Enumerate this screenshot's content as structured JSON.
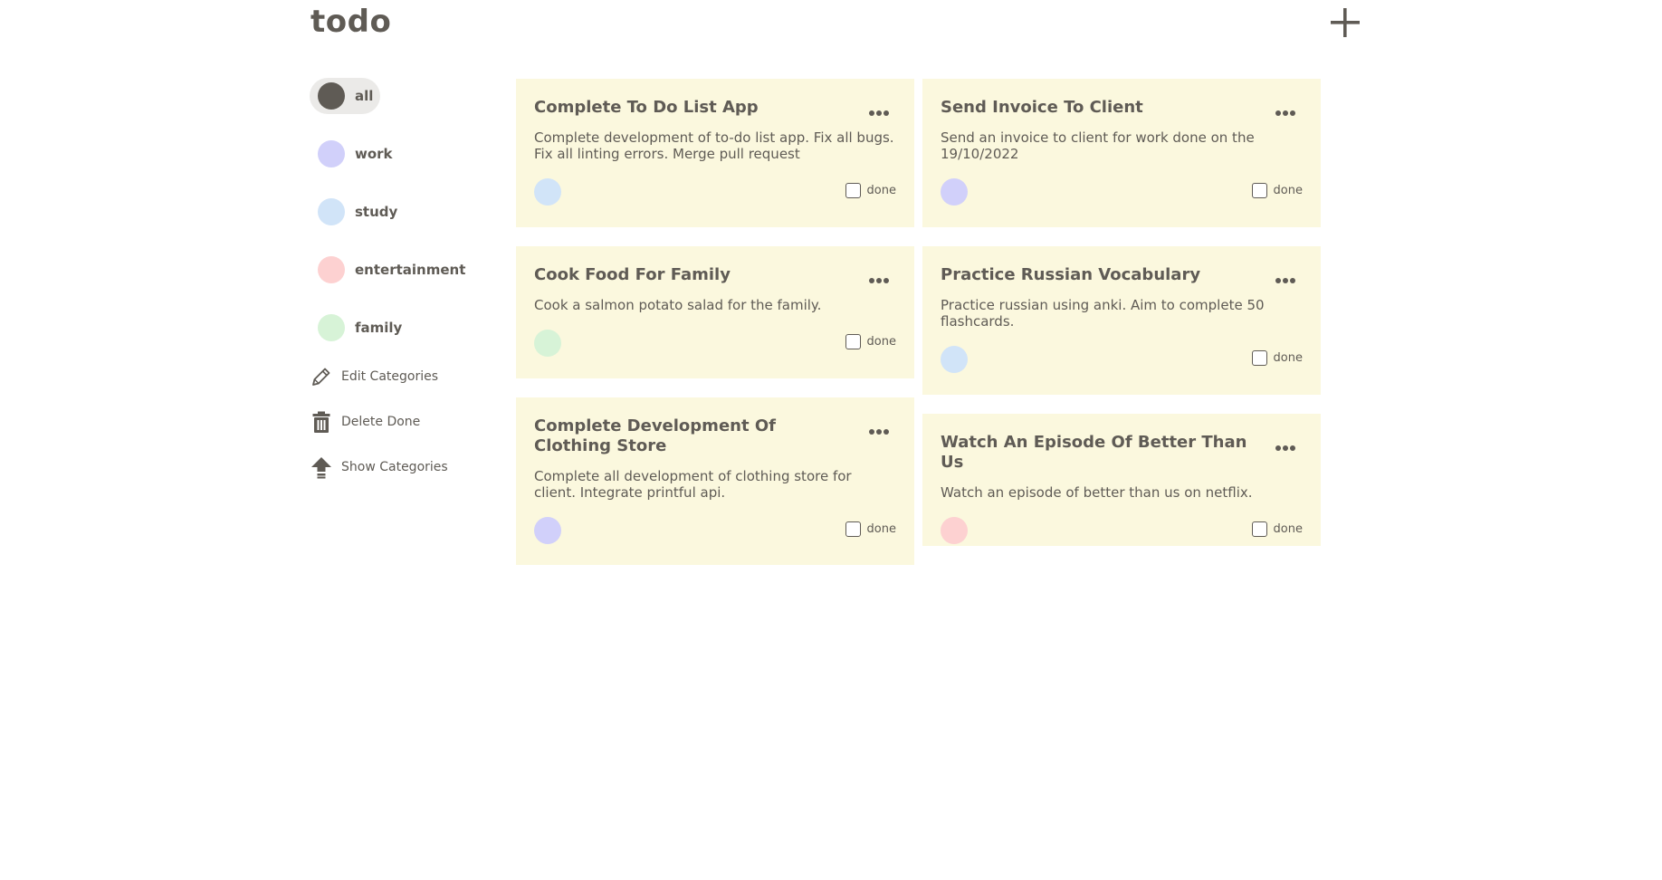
{
  "header": {
    "title": "todo",
    "add_icon": "plus-icon"
  },
  "sidebar": {
    "categories": [
      {
        "label": "all",
        "color": "#5f5b55",
        "active": true
      },
      {
        "label": "work",
        "color": "#d1d0fa"
      },
      {
        "label": "study",
        "color": "#d1e4f8"
      },
      {
        "label": "entertainment",
        "color": "#fdd1d1"
      },
      {
        "label": "family",
        "color": "#d7f3d7"
      }
    ],
    "actions": [
      {
        "label": "Edit Categories",
        "icon": "pencil-icon"
      },
      {
        "label": "Delete Done",
        "icon": "trash-icon"
      },
      {
        "label": "Show Categories",
        "icon": "arrow-up-icon"
      }
    ]
  },
  "cards": [
    {
      "title": "Complete To Do List App",
      "description": "Complete development of to-do list app. Fix all bugs. Fix all linting errors. Merge pull request",
      "category_color": "#d1e4f8",
      "done_label": "done",
      "done": false
    },
    {
      "title": "Send Invoice To Client",
      "description": "Send an invoice to client for work done on the 19/10/2022",
      "category_color": "#d1d0fa",
      "done_label": "done",
      "done": false
    },
    {
      "title": "Cook Food For Family",
      "description": "Cook a salmon potato salad for the family.",
      "category_color": "#d7f3d7",
      "done_label": "done",
      "done": false
    },
    {
      "title": "Practice Russian Vocabulary",
      "description": "Practice russian using anki. Aim to complete 50 flashcards.",
      "category_color": "#d1e4f8",
      "done_label": "done",
      "done": false
    },
    {
      "title": "Complete Development Of Clothing Store",
      "description": "Complete all development of clothing store for client. Integrate printful api.",
      "category_color": "#d1d0fa",
      "done_label": "done",
      "done": false
    },
    {
      "title": "Watch An Episode Of Better Than Us",
      "description": "Watch an episode of better than us on netflix.",
      "category_color": "#fdd1d1",
      "done_label": "done",
      "done": false
    }
  ],
  "colors": {
    "card_bg": "#fbf8de",
    "text": "#5f5b55",
    "active_bg": "#ebeae8"
  }
}
